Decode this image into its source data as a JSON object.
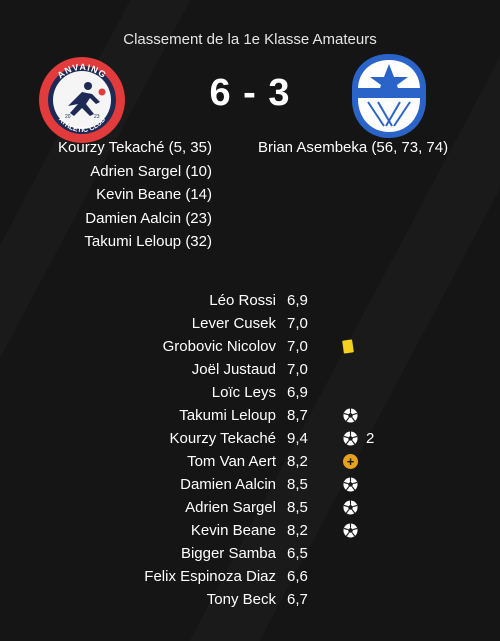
{
  "header": {
    "competition": "Classement de la 1e Klasse Amateurs"
  },
  "home": {
    "crest_top_text": "ANVAING",
    "crest_bottom_text": "ATHLETIC CLUB",
    "crest_year_left": "20",
    "crest_year_right": "23",
    "score": "6",
    "scorers": [
      "Kourzy Tekaché (5, 35)",
      "Adrien Sargel (10)",
      "Kevin Beane (14)",
      "Damien Aalcin (23)",
      "Takumi Leloup (32)"
    ]
  },
  "away": {
    "score": "3",
    "scorers": [
      "Brian Asembeka (56, 73, 74)"
    ]
  },
  "score_separator": "-",
  "score_line": "6 - 3",
  "players": [
    {
      "name": "Léo Rossi",
      "rating": "6,9",
      "events": []
    },
    {
      "name": "Lever Cusek",
      "rating": "7,0",
      "events": []
    },
    {
      "name": "Grobovic Nicolov",
      "rating": "7,0",
      "events": [
        "yellow-card"
      ]
    },
    {
      "name": "Joël Justaud",
      "rating": "7,0",
      "events": []
    },
    {
      "name": "Loïc Leys",
      "rating": "6,9",
      "events": []
    },
    {
      "name": "Takumi Leloup",
      "rating": "8,7",
      "events": [
        "goal"
      ]
    },
    {
      "name": "Kourzy Tekaché",
      "rating": "9,4",
      "events": [
        "goal"
      ],
      "goal_count": "2"
    },
    {
      "name": "Tom Van Aert",
      "rating": "8,2",
      "events": [
        "assist"
      ]
    },
    {
      "name": "Damien Aalcin",
      "rating": "8,5",
      "events": [
        "goal"
      ]
    },
    {
      "name": "Adrien Sargel",
      "rating": "8,5",
      "events": [
        "goal"
      ]
    },
    {
      "name": "Kevin Beane",
      "rating": "8,2",
      "events": [
        "goal"
      ]
    },
    {
      "name": "Bigger Samba",
      "rating": "6,5",
      "events": []
    },
    {
      "name": "Felix Espinoza Diaz",
      "rating": "6,6",
      "events": []
    },
    {
      "name": "Tony Beck",
      "rating": "6,7",
      "events": []
    }
  ],
  "colors": {
    "background": "#151515",
    "home_crest_red": "#e23b3b",
    "home_crest_navy": "#1c2a55",
    "away_crest_blue": "#2a64c8",
    "yellow_card": "#f2d21b",
    "assist": "#e8a21a"
  }
}
